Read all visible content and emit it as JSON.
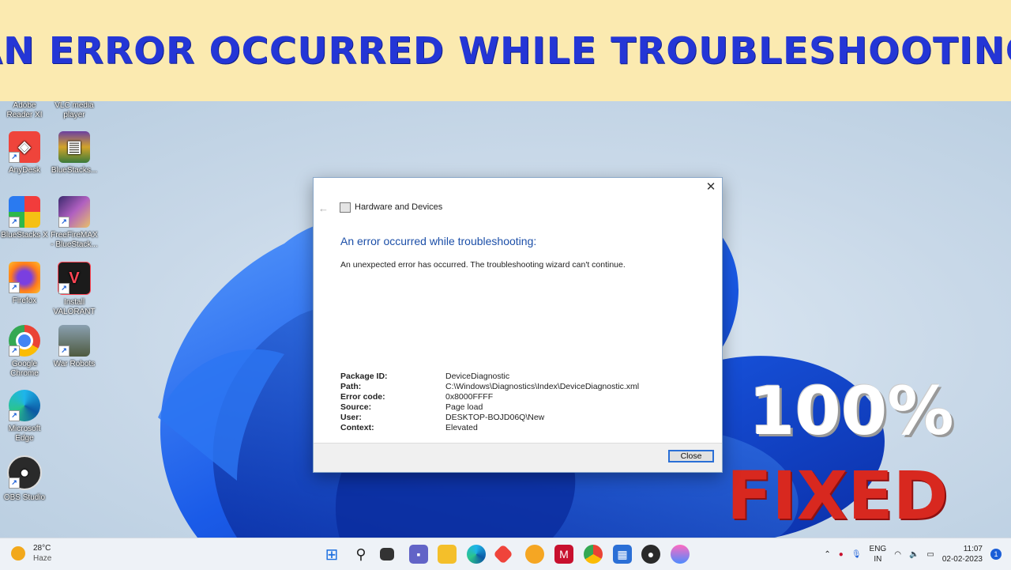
{
  "banner": {
    "title": "AN ERROR OCCURRED WHILE TROUBLESHOOTING"
  },
  "desktop_icons": [
    {
      "label": "Adobe Reader XI"
    },
    {
      "label": "VLC media player"
    },
    {
      "label": "AnyDesk"
    },
    {
      "label": "BlueStacks..."
    },
    {
      "label": "BlueStacks X"
    },
    {
      "label": "FreeFireMAX - BlueStack..."
    },
    {
      "label": "Firefox"
    },
    {
      "label": "Install VALORANT"
    },
    {
      "label": "Google Chrome"
    },
    {
      "label": "War Robots"
    },
    {
      "label": "Microsoft Edge"
    },
    {
      "label": "OBS Studio"
    }
  ],
  "dialog": {
    "title": "Hardware and Devices",
    "heading": "An error occurred while troubleshooting:",
    "message": "An unexpected error has occurred. The troubleshooting wizard can't continue.",
    "details": [
      {
        "key": "Package ID:",
        "value": "DeviceDiagnostic"
      },
      {
        "key": "Path:",
        "value": "C:\\Windows\\Diagnostics\\Index\\DeviceDiagnostic.xml"
      },
      {
        "key": "Error code:",
        "value": "0x8000FFFF"
      },
      {
        "key": "Source:",
        "value": "Page load"
      },
      {
        "key": "User:",
        "value": "DESKTOP-BOJD06Q\\New"
      },
      {
        "key": "Context:",
        "value": "Elevated"
      }
    ],
    "close_label": "Close",
    "close_glyph": "✕",
    "back_glyph": "←"
  },
  "promo": {
    "percent": "100%",
    "fixed": "FIXED"
  },
  "taskbar": {
    "weather_temp": "28°C",
    "weather_desc": "Haze",
    "lang_top": "ENG",
    "lang_bottom": "IN",
    "time": "11:07",
    "date": "02-02-2023",
    "notification_count": "1"
  },
  "colors": {
    "banner_bg": "#fbeab0",
    "banner_text": "#2436d6",
    "dialog_heading": "#1c4fa8",
    "fixed_red": "#d8281f"
  }
}
